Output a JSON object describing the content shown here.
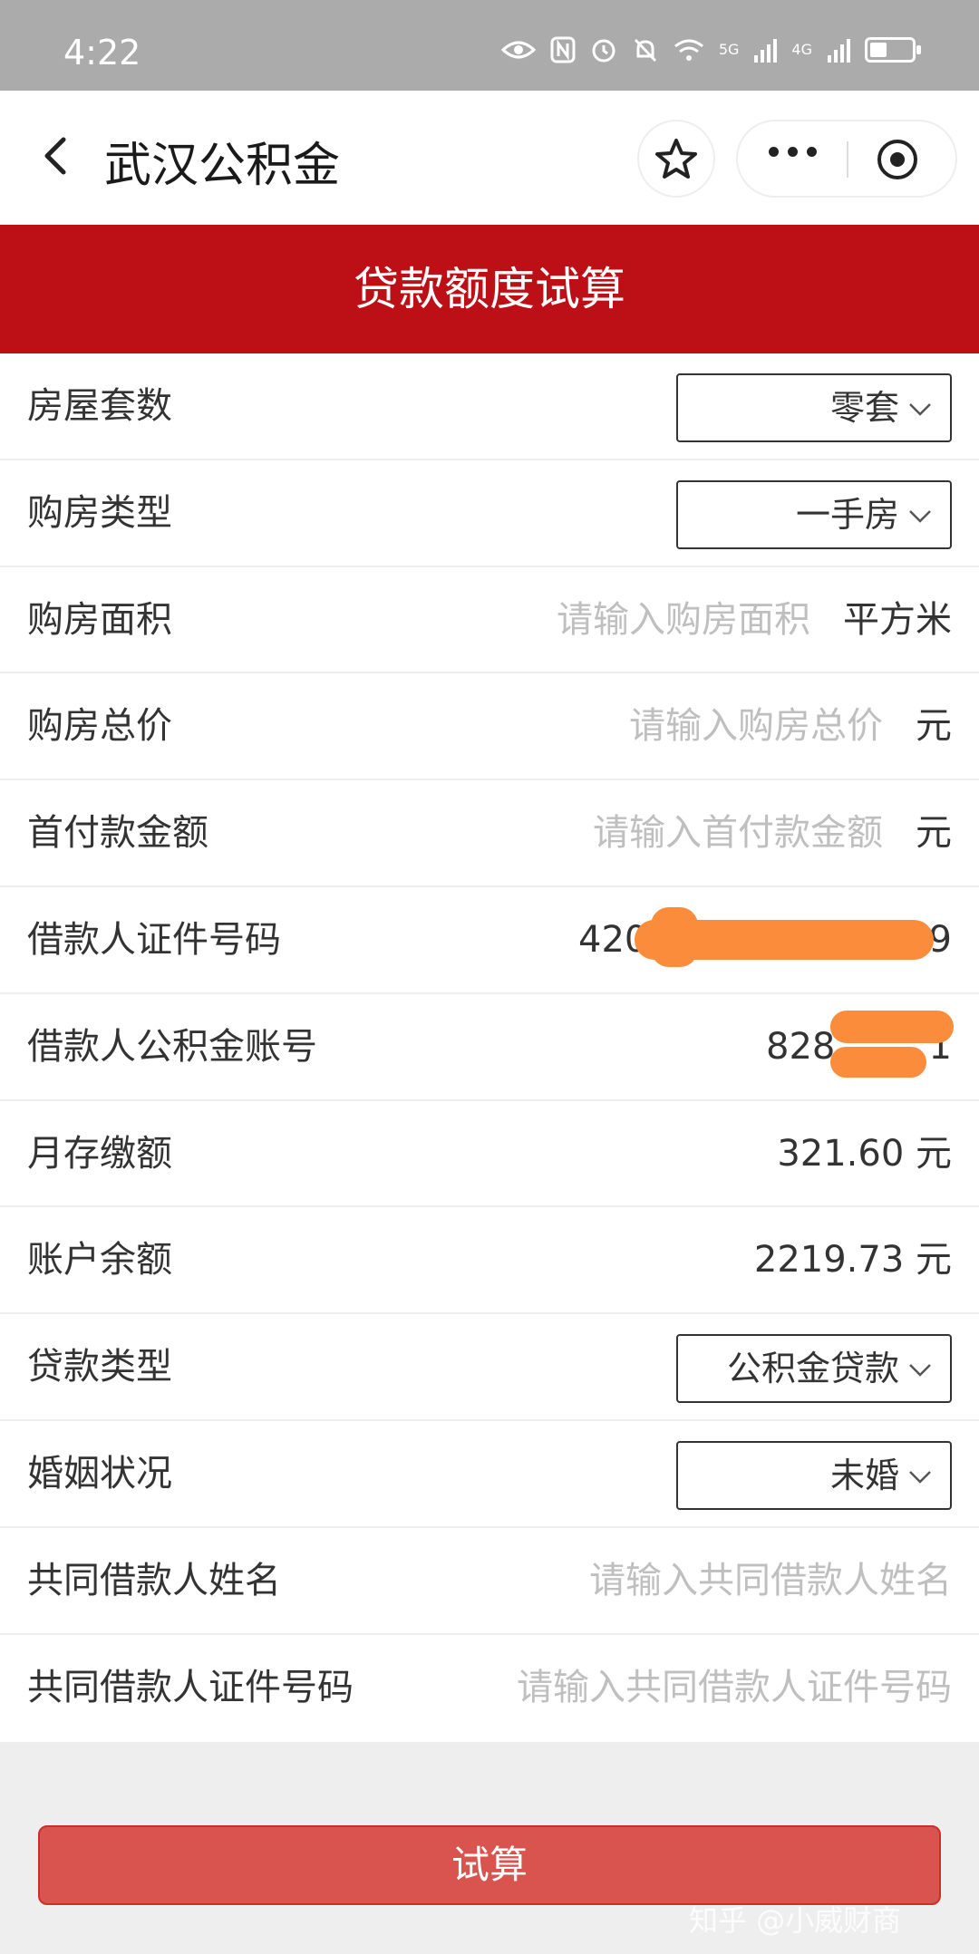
{
  "status_bar": {
    "time": "4:22",
    "net1": "5G",
    "net2": "4G",
    "battery_level": 0.4
  },
  "nav": {
    "title": "武汉公积金",
    "back_icon": "chevron-left-icon",
    "favorite_icon": "star-icon",
    "more_icon": "more-dots-icon",
    "close_icon": "target-circle-icon"
  },
  "header": {
    "title": "贷款额度试算"
  },
  "form": {
    "house_count": {
      "label": "房屋套数",
      "value": "零套"
    },
    "purchase_type": {
      "label": "购房类型",
      "value": "一手房"
    },
    "area": {
      "label": "购房面积",
      "placeholder": "请输入购房面积",
      "unit": "平方米"
    },
    "total_price": {
      "label": "购房总价",
      "placeholder": "请输入购房总价",
      "unit": "元"
    },
    "down_payment": {
      "label": "首付款金额",
      "placeholder": "请输入首付款金额",
      "unit": "元"
    },
    "id_number": {
      "label": "借款人证件号码",
      "prefix": "420",
      "suffix": "9"
    },
    "fund_account": {
      "label": "借款人公积金账号",
      "prefix": "828",
      "suffix": "1"
    },
    "monthly_deposit": {
      "label": "月存缴额",
      "value": "321.60 元"
    },
    "balance": {
      "label": "账户余额",
      "value": "2219.73 元"
    },
    "loan_type": {
      "label": "贷款类型",
      "value": "公积金贷款"
    },
    "marital_status": {
      "label": "婚姻状况",
      "value": "未婚"
    },
    "co_borrower_name": {
      "label": "共同借款人姓名",
      "placeholder": "请输入共同借款人姓名"
    },
    "co_borrower_id": {
      "label": "共同借款人证件号码",
      "placeholder": "请输入共同借款人证件号码"
    }
  },
  "submit": {
    "label": "试算"
  },
  "watermark": {
    "text": "知乎 @小威财商"
  },
  "colors": {
    "header_red": "#bd1016",
    "button_red": "#d9534f",
    "mask_orange": "#fa8c3c"
  }
}
